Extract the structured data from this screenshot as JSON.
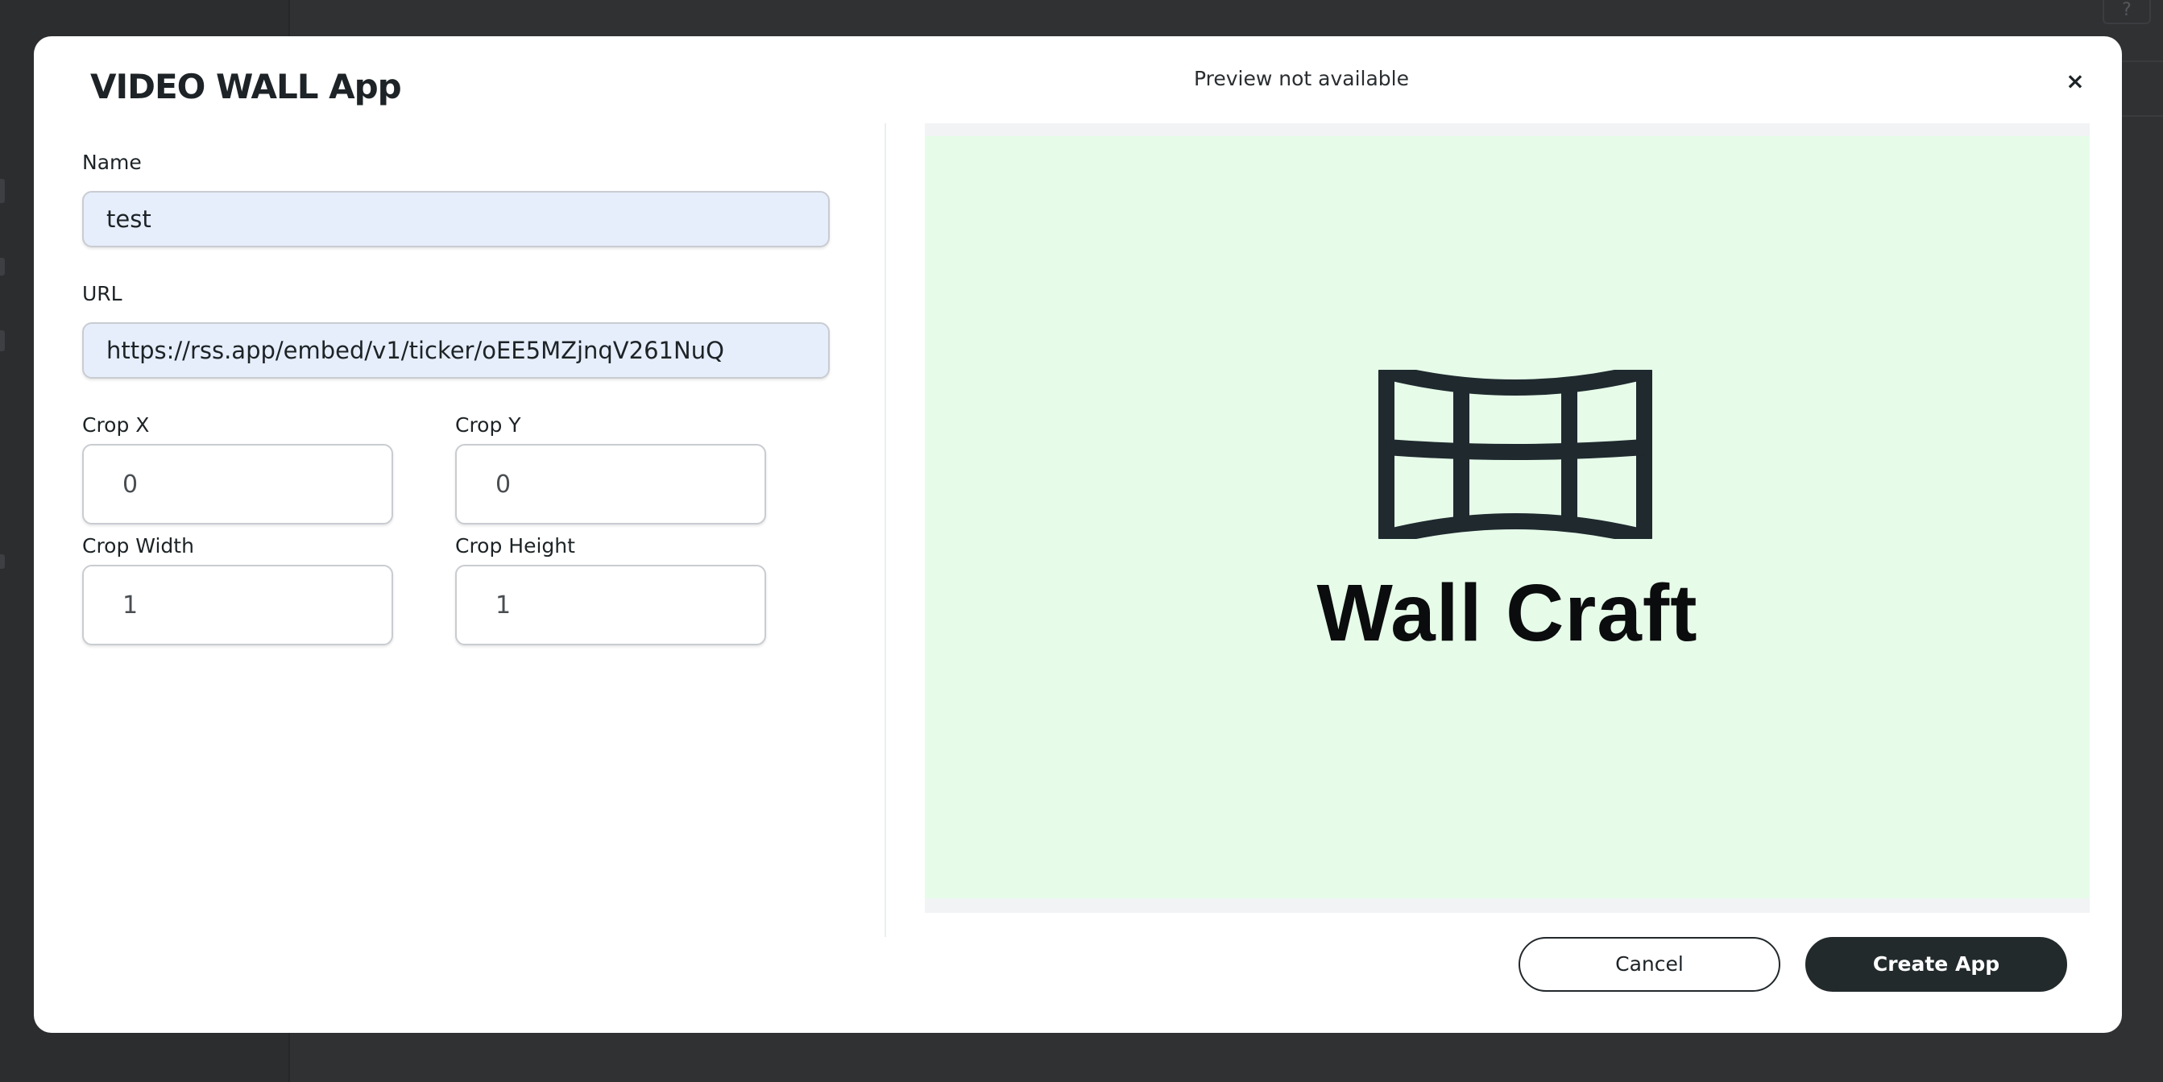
{
  "background": {
    "help_glyph": "?"
  },
  "modal": {
    "title": "VIDEO WALL App",
    "preview_status": "Preview not available",
    "close_glyph": "×"
  },
  "form": {
    "name": {
      "label": "Name",
      "value": "test"
    },
    "url": {
      "label": "URL",
      "value": "https://rss.app/embed/v1/ticker/oEE5MZjnqV261NuQ"
    },
    "crop_x": {
      "label": "Crop X",
      "value": "0"
    },
    "crop_y": {
      "label": "Crop Y",
      "value": "0"
    },
    "crop_width": {
      "label": "Crop Width",
      "value": "1"
    },
    "crop_height": {
      "label": "Crop Height",
      "value": "1"
    }
  },
  "preview": {
    "logo_text": "Wall Craft",
    "logo_icon": "video-wall-icon",
    "background_color": "#e6fce9"
  },
  "actions": {
    "cancel_label": "Cancel",
    "create_label": "Create App"
  },
  "colors": {
    "overlay": "#303133",
    "primary_button": "#232a2c",
    "input_fill": "#e6eefb"
  }
}
